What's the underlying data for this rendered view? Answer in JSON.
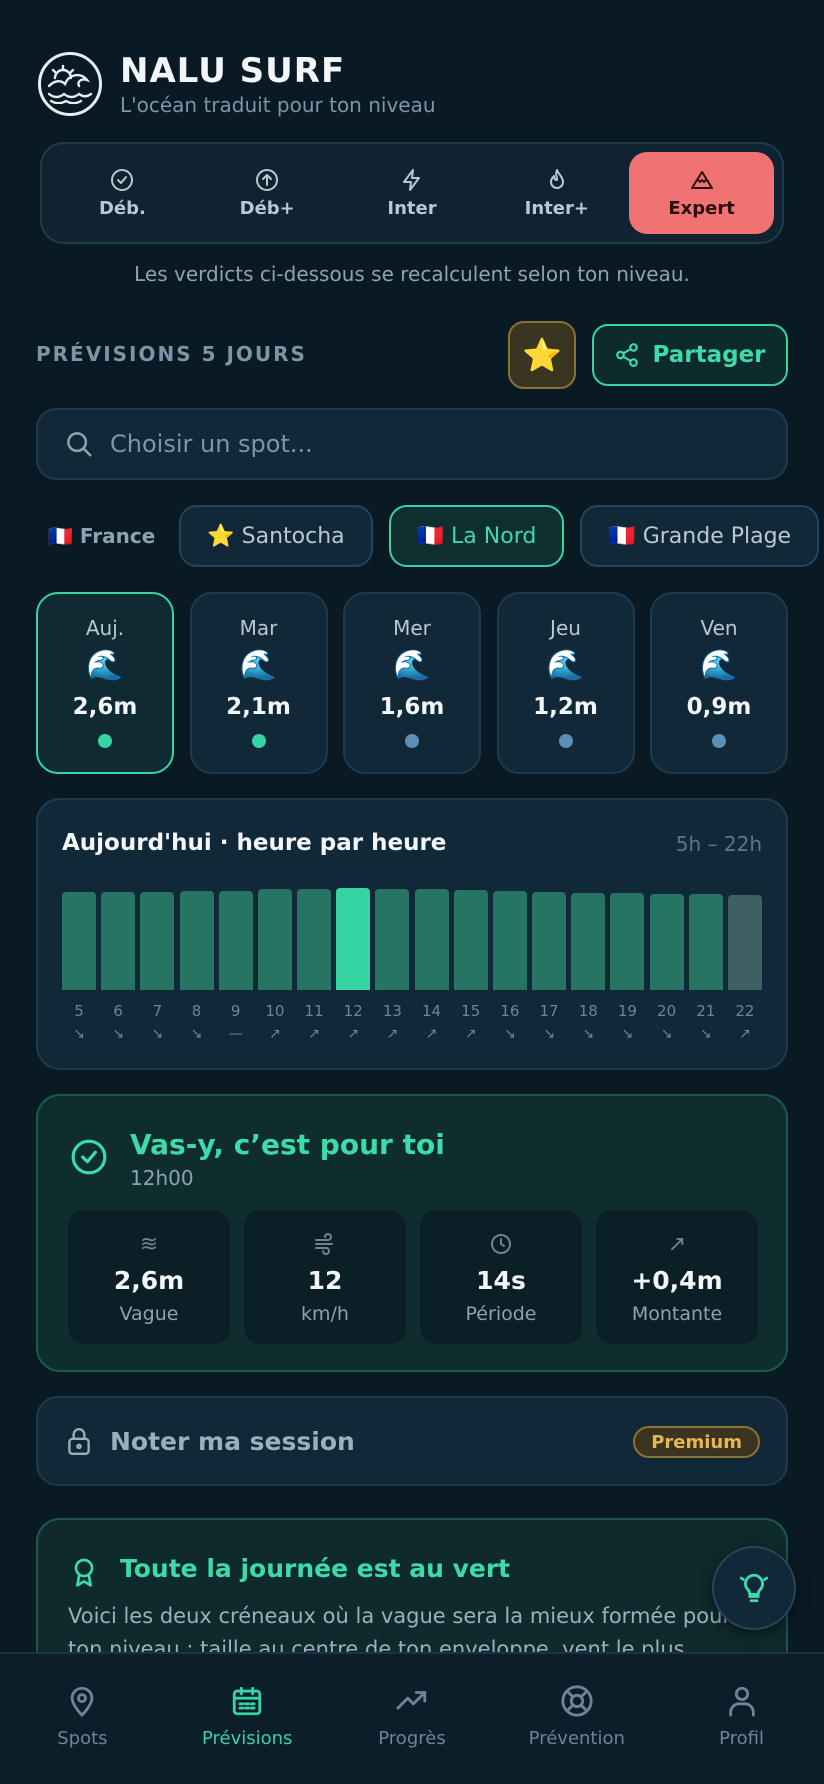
{
  "app": {
    "title": "NALU SURF",
    "subtitle": "L'océan traduit pour ton niveau"
  },
  "levels": {
    "items": [
      {
        "label": "Déb.",
        "icon": "check-circle-icon"
      },
      {
        "label": "Déb+",
        "icon": "arrow-up-circle-icon"
      },
      {
        "label": "Inter",
        "icon": "lightning-icon"
      },
      {
        "label": "Inter+",
        "icon": "flame-icon"
      },
      {
        "label": "Expert",
        "icon": "mountain-icon",
        "active": true
      }
    ],
    "note": "Les verdicts ci-dessous se recalculent selon ton niveau."
  },
  "forecast": {
    "title": "PRÉVISIONS 5 JOURS",
    "fav_icon": "⭐",
    "share_label": "Partager"
  },
  "search": {
    "placeholder": "Choisir un spot..."
  },
  "chips": {
    "country_label": "🇫🇷 France",
    "items": [
      {
        "label": "⭐ Santocha",
        "active": false
      },
      {
        "label": "🇫🇷 La Nord",
        "active": true
      },
      {
        "label": "🇫🇷 Grande Plage",
        "active": false
      }
    ]
  },
  "days": [
    {
      "name": "Auj.",
      "icon": "🌊",
      "height": "2,6m",
      "dot": "#36d3a3",
      "active": true
    },
    {
      "name": "Mar",
      "icon": "🌊",
      "height": "2,1m",
      "dot": "#36d3a3",
      "active": false
    },
    {
      "name": "Mer",
      "icon": "🌊",
      "height": "1,6m",
      "dot": "#5b8fb5",
      "active": false
    },
    {
      "name": "Jeu",
      "icon": "🌊",
      "height": "1,2m",
      "dot": "#5b8fb5",
      "active": false
    },
    {
      "name": "Ven",
      "icon": "🌊",
      "height": "0,9m",
      "dot": "#5b8fb5",
      "active": false
    }
  ],
  "hourly": {
    "title": "Aujourd'hui · heure par heure",
    "range": "5h – 22h",
    "hours": [
      "5",
      "6",
      "7",
      "8",
      "9",
      "10",
      "11",
      "12",
      "13",
      "14",
      "15",
      "16",
      "17",
      "18",
      "19",
      "20",
      "21",
      "22"
    ],
    "levels": [
      0.89,
      0.89,
      0.89,
      0.9,
      0.9,
      0.92,
      0.92,
      0.93,
      0.92,
      0.92,
      0.91,
      0.9,
      0.89,
      0.88,
      0.88,
      0.87,
      0.87,
      0.86
    ],
    "directions": [
      "↘",
      "↘",
      "↘",
      "↘",
      "—",
      "↗",
      "↗",
      "↗",
      "↗",
      "↗",
      "↗",
      "↘",
      "↘",
      "↘",
      "↘",
      "↘",
      "↘",
      "↗"
    ],
    "peak_index": 7,
    "dim_index": 17
  },
  "verdict": {
    "title": "Vas-y, c’est pour toi",
    "time": "12h00",
    "stats": [
      {
        "icon": "≋",
        "value": "2,6m",
        "label": "Vague"
      },
      {
        "icon": "wind-icon",
        "value": "12",
        "label": "km/h"
      },
      {
        "icon": "clock-icon",
        "value": "14s",
        "label": "Période"
      },
      {
        "icon": "↗",
        "value": "+0,4m",
        "label": "Montante"
      }
    ]
  },
  "session": {
    "label": "Noter ma session",
    "badge": "Premium"
  },
  "allday": {
    "title": "Toute la journée est au vert",
    "text": "Voici les deux créneaux où la vague sera la mieux formée pour ton niveau : taille au centre de ton enveloppe, vent le plus"
  },
  "nav": [
    {
      "label": "Spots",
      "icon": "map-pin-icon",
      "active": false
    },
    {
      "label": "Prévisions",
      "icon": "calendar-icon",
      "active": true
    },
    {
      "label": "Progrès",
      "icon": "trending-up-icon",
      "active": false
    },
    {
      "label": "Prévention",
      "icon": "lifebuoy-icon",
      "active": false
    },
    {
      "label": "Profil",
      "icon": "user-icon",
      "active": false
    }
  ],
  "colors": {
    "background": "#0a1a24",
    "accent": "#36d3a3",
    "expert": "#f07272",
    "premium": "#e8b650"
  }
}
